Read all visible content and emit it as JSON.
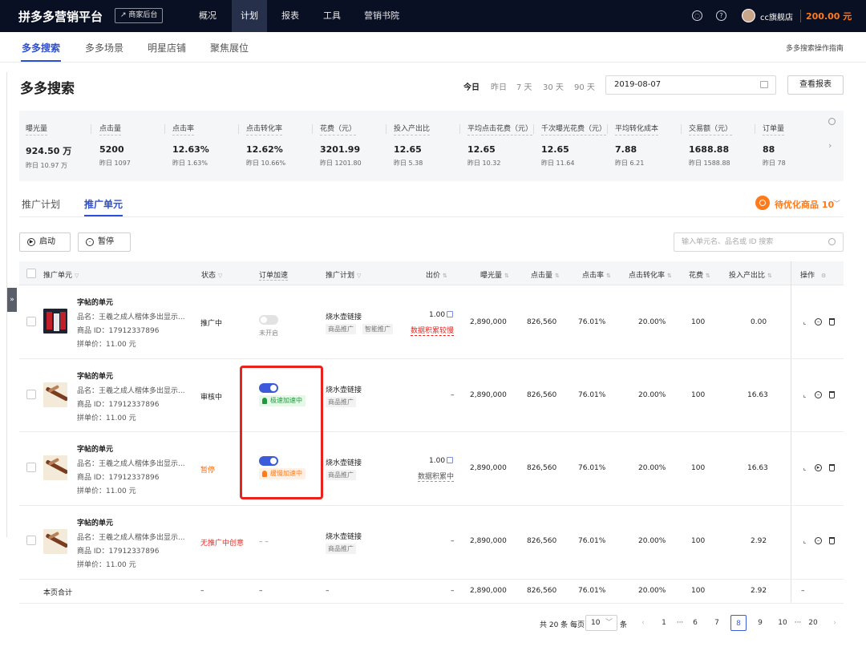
{
  "topbar": {
    "logo": "拼多多营销平台",
    "merchant_button": "↗ 商家后台",
    "nav": [
      "概况",
      "计划",
      "报表",
      "工具",
      "营销书院"
    ],
    "active_nav": "计划",
    "bell_icon": "bell-icon",
    "help_icon": "help-icon",
    "shop_name": "cc旗舰店",
    "balance": "200.00 元"
  },
  "subnav": {
    "items": [
      "多多搜索",
      "多多场景",
      "明星店铺",
      "聚焦展位"
    ],
    "active": "多多搜索",
    "guide_link": "多多搜索操作指南"
  },
  "page": {
    "title": "多多搜索",
    "date_ranges": [
      "今日",
      "昨日",
      "7 天",
      "30 天",
      "90 天"
    ],
    "active_range": "今日",
    "date_value": "2019-08-07",
    "report_button": "查看报表"
  },
  "stats": [
    {
      "label": "曝光量",
      "value": "924.50 万",
      "prev": "昨日 10.97 万"
    },
    {
      "label": "点击量",
      "value": "5200",
      "prev": "昨日 1097"
    },
    {
      "label": "点击率",
      "value": "12.63%",
      "prev": "昨日 1.63%"
    },
    {
      "label": "点击转化率",
      "value": "12.62%",
      "prev": "昨日 10.66%"
    },
    {
      "label": "花费（元）",
      "value": "3201.99",
      "prev": "昨日 1201.80"
    },
    {
      "label": "投入产出比",
      "value": "12.65",
      "prev": "昨日 5.38"
    },
    {
      "label": "平均点击花费（元）",
      "value": "12.65",
      "prev": "昨日 10.32"
    },
    {
      "label": "千次曝光花费（元）",
      "value": "12.65",
      "prev": "昨日 11.64"
    },
    {
      "label": "平均转化成本",
      "value": "7.88",
      "prev": "昨日 6.21"
    },
    {
      "label": "交易额（元）",
      "value": "1688.88",
      "prev": "昨日 1588.88"
    },
    {
      "label": "订单量",
      "value": "88",
      "prev": "昨日 78"
    }
  ],
  "tabs": {
    "items": [
      "推广计划",
      "推广单元"
    ],
    "active": "推广单元",
    "optimize_label": "待优化商品 10"
  },
  "toolbar": {
    "start_button": "启动",
    "pause_button": "暂停",
    "search_placeholder": "输入单元名、品名或 ID 搜索"
  },
  "table": {
    "headers": {
      "unit": "推广单元",
      "status": "状态",
      "order_boost": "订单加速",
      "plan": "推广计划",
      "bid": "出价",
      "impressions": "曝光量",
      "clicks": "点击量",
      "ctr": "点击率",
      "cvr": "点击转化率",
      "cost": "花费",
      "roi": "投入产出比",
      "ops": "操作"
    },
    "rows": [
      {
        "title": "字帖的单元",
        "product_name": "品名：王羲之成人楷体多出显示...",
        "product_id": "商品 ID：17912337896",
        "price": "拼单价：11.00 元",
        "status": "推广中",
        "boost_text": "未开启",
        "plan": "烧水壶链接",
        "tags": [
          "商品推广",
          "智能推广"
        ],
        "bid": "1.00",
        "bid_note": "数据积累较慢",
        "impressions": "2,890,000",
        "clicks": "826,560",
        "ctr": "76.01%",
        "cvr": "20.00%",
        "cost": "100",
        "roi": "0.00"
      },
      {
        "title": "字帖的单元",
        "product_name": "品名：王羲之成人楷体多出显示...",
        "product_id": "商品 ID：17912337896",
        "price": "拼单价：11.00 元",
        "status": "审核中",
        "boost_text": "极速加速中",
        "plan": "烧水壶链接",
        "tags": [
          "商品推广"
        ],
        "bid": "–",
        "impressions": "2,890,000",
        "clicks": "826,560",
        "ctr": "76.01%",
        "cvr": "20.00%",
        "cost": "100",
        "roi": "16.63"
      },
      {
        "title": "字帖的单元",
        "product_name": "品名：王羲之成人楷体多出显示...",
        "product_id": "商品 ID：17912337896",
        "price": "拼单价：11.00 元",
        "status": "暂停",
        "boost_text": "缓慢加速中",
        "plan": "烧水壶链接",
        "tags": [
          "商品推广"
        ],
        "bid": "1.00",
        "bid_note": "数据积累中",
        "impressions": "2,890,000",
        "clicks": "826,560",
        "ctr": "76.01%",
        "cvr": "20.00%",
        "cost": "100",
        "roi": "16.63"
      },
      {
        "title": "字帖的单元",
        "product_name": "品名：王羲之成人楷体多出显示...",
        "product_id": "商品 ID：17912337896",
        "price": "拼单价：11.00 元",
        "status": "无推广中创意",
        "boost_text": "– –",
        "plan": "烧水壶链接",
        "tags": [
          "商品推广"
        ],
        "bid": "–",
        "impressions": "2,890,000",
        "clicks": "826,560",
        "ctr": "76.01%",
        "cvr": "20.00%",
        "cost": "100",
        "roi": "2.92"
      }
    ],
    "total": {
      "label": "本页合计",
      "status": "–",
      "boost": "–",
      "plan": "–",
      "bid": "–",
      "impressions": "2,890,000",
      "clicks": "826,560",
      "ctr": "76.01%",
      "cvr": "20.00%",
      "cost": "100",
      "roi": "2.92",
      "ops": "–"
    }
  },
  "pagination": {
    "total_text": "共 20 条 每页",
    "page_size": "10",
    "unit": "条",
    "pages": [
      "1",
      "···",
      "6",
      "7",
      "8",
      "9",
      "10",
      "···",
      "20"
    ],
    "current": "8"
  },
  "colors": {
    "accent": "#2b4fd8",
    "warning": "#ff7a1a",
    "danger": "#f0241d",
    "highlight": "#e8231e"
  }
}
